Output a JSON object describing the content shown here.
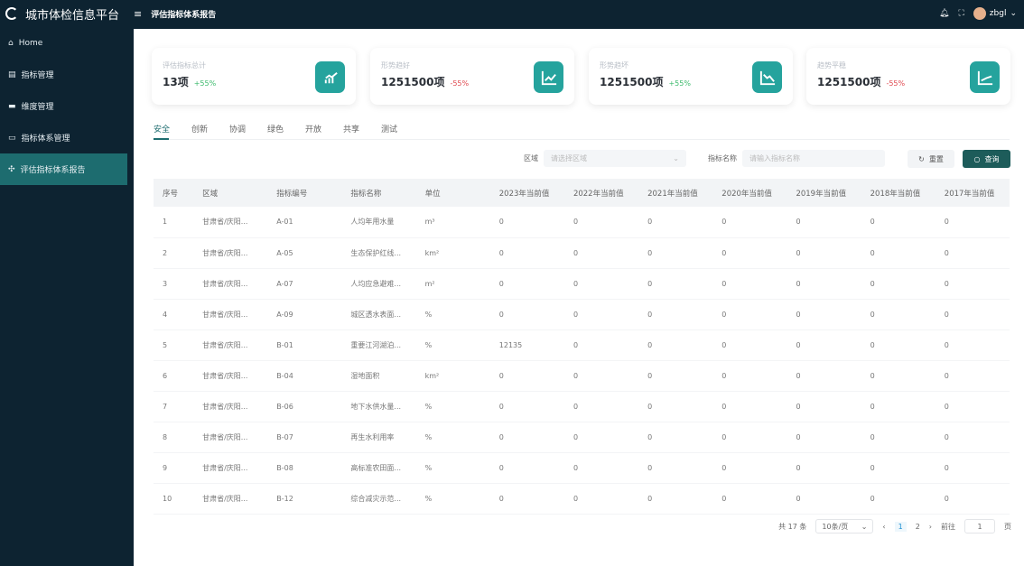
{
  "header": {
    "app_title": "城市体检信息平台",
    "breadcrumb": "评估指标体系报告",
    "username": "zbgl"
  },
  "sidebar": {
    "items": [
      {
        "label": "Home",
        "icon": "home-icon"
      },
      {
        "label": "指标管理",
        "icon": "table-icon"
      },
      {
        "label": "维度管理",
        "icon": "card-icon"
      },
      {
        "label": "指标体系管理",
        "icon": "folder-icon"
      },
      {
        "label": "评估指标体系报告",
        "icon": "grid-icon",
        "active": true
      }
    ]
  },
  "cards": [
    {
      "label": "评估指标总计",
      "value": "13项",
      "delta": "+55%",
      "trend": "up",
      "icon": "bar-chart-up-icon"
    },
    {
      "label": "形势趋好",
      "value": "1251500项",
      "delta": "-55%",
      "trend": "down",
      "icon": "line-chart-up-icon"
    },
    {
      "label": "形势趋坏",
      "value": "1251500项",
      "delta": "+55%",
      "trend": "up",
      "icon": "line-chart-down-icon"
    },
    {
      "label": "趋势平稳",
      "value": "1251500项",
      "delta": "-55%",
      "trend": "down",
      "icon": "line-chart-flat-icon"
    }
  ],
  "tabs": [
    "安全",
    "创新",
    "协调",
    "绿色",
    "开放",
    "共享",
    "测试"
  ],
  "filters": {
    "region_label": "区域",
    "region_placeholder": "请选择区域",
    "name_label": "指标名称",
    "name_placeholder": "请输入指标名称",
    "reset": "重置",
    "search": "查询"
  },
  "table": {
    "headers": [
      "序号",
      "区域",
      "指标编号",
      "指标名称",
      "单位",
      "2023年当前值",
      "2022年当前值",
      "2021年当前值",
      "2020年当前值",
      "2019年当前值",
      "2018年当前值",
      "2017年当前值"
    ],
    "rows": [
      [
        "1",
        "甘肃省/庆阳...",
        "A-01",
        "人均年用水量",
        "m³",
        "0",
        "0",
        "0",
        "0",
        "0",
        "0",
        "0"
      ],
      [
        "2",
        "甘肃省/庆阳...",
        "A-05",
        "生态保护红线...",
        "km²",
        "0",
        "0",
        "0",
        "0",
        "0",
        "0",
        "0"
      ],
      [
        "3",
        "甘肃省/庆阳...",
        "A-07",
        "人均应急避难...",
        "m²",
        "0",
        "0",
        "0",
        "0",
        "0",
        "0",
        "0"
      ],
      [
        "4",
        "甘肃省/庆阳...",
        "A-09",
        "城区透水表面...",
        "%",
        "0",
        "0",
        "0",
        "0",
        "0",
        "0",
        "0"
      ],
      [
        "5",
        "甘肃省/庆阳...",
        "B-01",
        "重要江河湖泊...",
        "%",
        "12135",
        "0",
        "0",
        "0",
        "0",
        "0",
        "0"
      ],
      [
        "6",
        "甘肃省/庆阳...",
        "B-04",
        "湿地面积",
        "km²",
        "0",
        "0",
        "0",
        "0",
        "0",
        "0",
        "0"
      ],
      [
        "7",
        "甘肃省/庆阳...",
        "B-06",
        "地下水供水量...",
        "%",
        "0",
        "0",
        "0",
        "0",
        "0",
        "0",
        "0"
      ],
      [
        "8",
        "甘肃省/庆阳...",
        "B-07",
        "再生水利用率",
        "%",
        "0",
        "0",
        "0",
        "0",
        "0",
        "0",
        "0"
      ],
      [
        "9",
        "甘肃省/庆阳...",
        "B-08",
        "高标准农田面...",
        "%",
        "0",
        "0",
        "0",
        "0",
        "0",
        "0",
        "0"
      ],
      [
        "10",
        "甘肃省/庆阳...",
        "B-12",
        "综合减灾示范...",
        "%",
        "0",
        "0",
        "0",
        "0",
        "0",
        "0",
        "0"
      ]
    ]
  },
  "pagination": {
    "total": "共 17 条",
    "page_size": "10条/页",
    "pages": [
      "1",
      "2"
    ],
    "current": "1",
    "goto_label": "前往",
    "goto_value": "1",
    "goto_suffix": "页"
  },
  "colors": {
    "accent": "#1d6c6f",
    "icon_bg": "#25a39d",
    "nav_bg": "#0d2331",
    "up": "#3cba6c",
    "down": "#e0484f"
  }
}
